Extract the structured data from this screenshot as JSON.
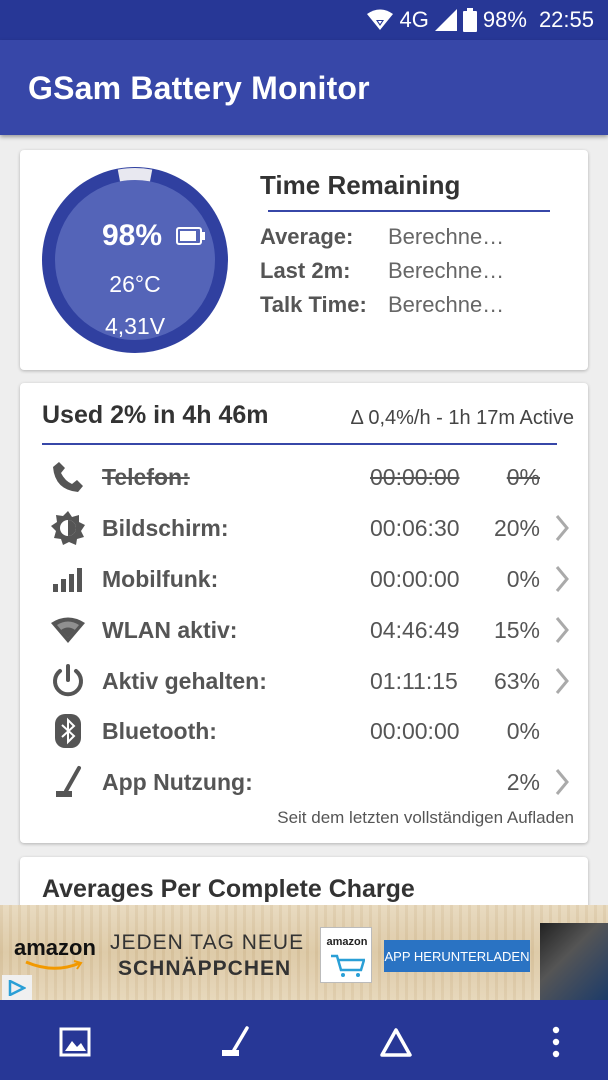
{
  "status_bar": {
    "network": "4G",
    "battery": "98%",
    "time": "22:55"
  },
  "app_bar": {
    "title": "GSam Battery Monitor"
  },
  "battery_card": {
    "percent": "98%",
    "level": 0.98,
    "temperature": "26°C",
    "voltage": "4,31V",
    "time_remaining_title": "Time Remaining",
    "rows": [
      {
        "label": "Average:",
        "value": "Berechne…"
      },
      {
        "label": "Last 2m:",
        "value": "Berechne…"
      },
      {
        "label": "Talk Time:",
        "value": "Berechne…"
      }
    ]
  },
  "usage_card": {
    "title": "Used 2% in 4h 46m",
    "rate": "Δ 0,4%/h - 1h 17m Active",
    "rows": [
      {
        "icon": "phone-icon",
        "name": "Telefon:",
        "time": "00:00:00",
        "pct": "0%",
        "strike": true,
        "chevron": false
      },
      {
        "icon": "screen-brightness-icon",
        "name": "Bildschirm:",
        "time": "00:06:30",
        "pct": "20%",
        "strike": false,
        "chevron": true
      },
      {
        "icon": "signal-bars-icon",
        "name": "Mobilfunk:",
        "time": "00:00:00",
        "pct": "0%",
        "strike": false,
        "chevron": true
      },
      {
        "icon": "wifi-icon",
        "name": "WLAN aktiv:",
        "time": "04:46:49",
        "pct": "15%",
        "strike": false,
        "chevron": true
      },
      {
        "icon": "power-icon",
        "name": "Aktiv gehalten:",
        "time": "01:11:15",
        "pct": "63%",
        "strike": false,
        "chevron": true
      },
      {
        "icon": "bluetooth-icon",
        "name": "Bluetooth:",
        "time": "00:00:00",
        "pct": "0%",
        "strike": false,
        "chevron": false
      },
      {
        "icon": "app-usage-icon",
        "name": "App Nutzung:",
        "time": "",
        "pct": "2%",
        "strike": false,
        "chevron": true
      }
    ],
    "footer": "Seit dem letzten vollständigen Aufladen"
  },
  "averages_card": {
    "title": "Averages Per Complete Charge"
  },
  "ad": {
    "brand": "amazon",
    "line1": "JEDEN TAG NEUE",
    "line2": "SCHNÄPPCHEN",
    "box_brand": "amazon",
    "button": "APP HERUNTERLADEN"
  },
  "bottom_nav": [
    "image-icon",
    "app-usage-icon",
    "triangle-icon",
    "more-vert-icon"
  ],
  "colors": {
    "primary": "#3747a8",
    "primary_dark": "#273796",
    "gauge_fill": "#5464b8"
  }
}
